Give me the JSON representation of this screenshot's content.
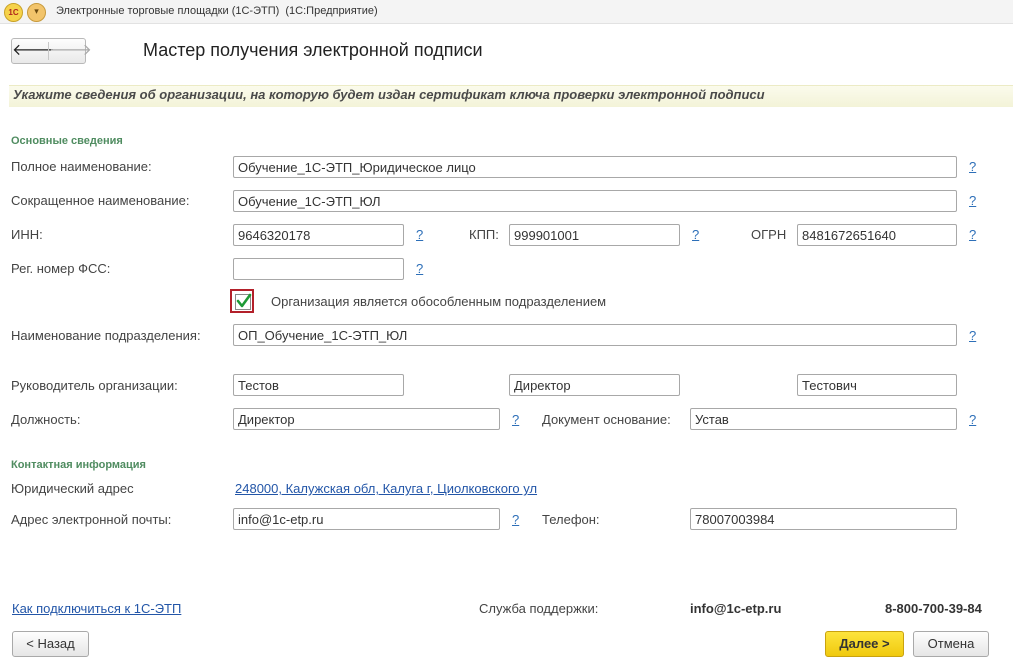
{
  "window": {
    "logo_text": "1С",
    "menu_icon": "chevron-down-icon",
    "title": "Электронные торговые площадки (1С-ЭТП)  (1С:Предприятие)"
  },
  "nav": {
    "back_icon": "arrow-left-icon",
    "forward_icon": "arrow-right-icon"
  },
  "page_title": "Мастер получения электронной подписи",
  "banner": "Укажите сведения об организации, на которую будет издан сертификат ключа проверки электронной подписи",
  "basic": {
    "section_title": "Основные сведения",
    "full_name": {
      "label": "Полное наименование:",
      "value": "Обучение_1С-ЭТП_Юридическое лицо"
    },
    "short_name": {
      "label": "Сокращенное наименование:",
      "value": "Обучение_1С-ЭТП_ЮЛ"
    },
    "inn": {
      "label": "ИНН:",
      "value": "9646320178"
    },
    "kpp": {
      "label": "КПП:",
      "value": "999901001"
    },
    "ogrn": {
      "label": "ОГРН",
      "value": "8481672651640"
    },
    "fss": {
      "label": "Рег. номер ФСС:",
      "value": ""
    },
    "separate_unit": {
      "label": "Организация является обособленным подразделением",
      "checked": true
    },
    "division_name": {
      "label": "Наименование подразделения:",
      "value": "ОП_Обучение_1С-ЭТП_ЮЛ"
    },
    "head": {
      "label": "Руководитель организации:",
      "last_name": "Тестов",
      "first_name": "Директор",
      "patronymic": "Тестович"
    },
    "position": {
      "label": "Должность:",
      "value": "Директор"
    },
    "basis_doc": {
      "label": "Документ основание:",
      "value": "Устав"
    }
  },
  "contacts": {
    "section_title": "Контактная информация",
    "legal_address": {
      "label": "Юридический адрес",
      "value": "248000, Калужская обл, Калуга г, Циолковского ул"
    },
    "email": {
      "label": "Адрес электронной почты:",
      "value": "info@1c-etp.ru"
    },
    "phone": {
      "label": "Телефон:",
      "value": "78007003984"
    }
  },
  "help_mark": "?",
  "footer": {
    "connect_link": "Как подключиться к 1С-ЭТП",
    "support_label": "Служба поддержки:",
    "support_email": "info@1c-etp.ru",
    "support_phone": "8-800-700-39-84",
    "back_button": "< Назад",
    "next_button": "Далее >",
    "cancel_button": "Отмена"
  },
  "colors": {
    "accent": "#f0c90e",
    "section": "#4f8c60",
    "link": "#2356a8",
    "highlight": "#b3202a"
  }
}
